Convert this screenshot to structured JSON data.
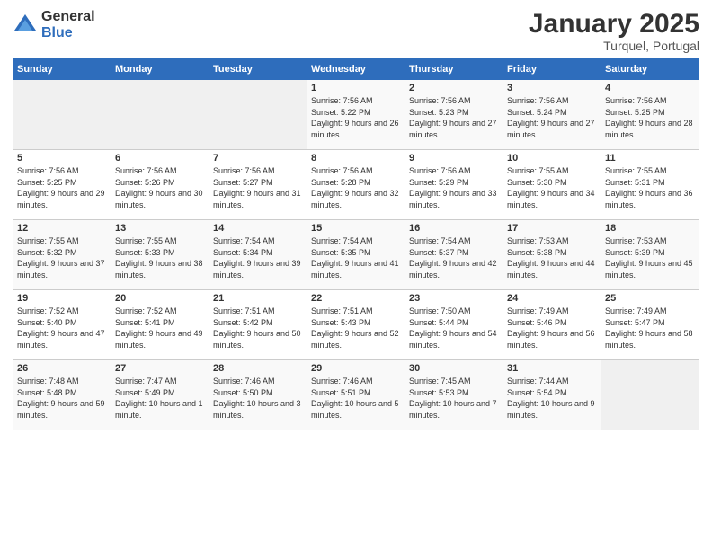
{
  "logo": {
    "text_general": "General",
    "text_blue": "Blue"
  },
  "header": {
    "title": "January 2025",
    "subtitle": "Turquel, Portugal"
  },
  "weekdays": [
    "Sunday",
    "Monday",
    "Tuesday",
    "Wednesday",
    "Thursday",
    "Friday",
    "Saturday"
  ],
  "weeks": [
    [
      {
        "day": "",
        "info": ""
      },
      {
        "day": "",
        "info": ""
      },
      {
        "day": "",
        "info": ""
      },
      {
        "day": "1",
        "info": "Sunrise: 7:56 AM\nSunset: 5:22 PM\nDaylight: 9 hours and 26 minutes."
      },
      {
        "day": "2",
        "info": "Sunrise: 7:56 AM\nSunset: 5:23 PM\nDaylight: 9 hours and 27 minutes."
      },
      {
        "day": "3",
        "info": "Sunrise: 7:56 AM\nSunset: 5:24 PM\nDaylight: 9 hours and 27 minutes."
      },
      {
        "day": "4",
        "info": "Sunrise: 7:56 AM\nSunset: 5:25 PM\nDaylight: 9 hours and 28 minutes."
      }
    ],
    [
      {
        "day": "5",
        "info": "Sunrise: 7:56 AM\nSunset: 5:25 PM\nDaylight: 9 hours and 29 minutes."
      },
      {
        "day": "6",
        "info": "Sunrise: 7:56 AM\nSunset: 5:26 PM\nDaylight: 9 hours and 30 minutes."
      },
      {
        "day": "7",
        "info": "Sunrise: 7:56 AM\nSunset: 5:27 PM\nDaylight: 9 hours and 31 minutes."
      },
      {
        "day": "8",
        "info": "Sunrise: 7:56 AM\nSunset: 5:28 PM\nDaylight: 9 hours and 32 minutes."
      },
      {
        "day": "9",
        "info": "Sunrise: 7:56 AM\nSunset: 5:29 PM\nDaylight: 9 hours and 33 minutes."
      },
      {
        "day": "10",
        "info": "Sunrise: 7:55 AM\nSunset: 5:30 PM\nDaylight: 9 hours and 34 minutes."
      },
      {
        "day": "11",
        "info": "Sunrise: 7:55 AM\nSunset: 5:31 PM\nDaylight: 9 hours and 36 minutes."
      }
    ],
    [
      {
        "day": "12",
        "info": "Sunrise: 7:55 AM\nSunset: 5:32 PM\nDaylight: 9 hours and 37 minutes."
      },
      {
        "day": "13",
        "info": "Sunrise: 7:55 AM\nSunset: 5:33 PM\nDaylight: 9 hours and 38 minutes."
      },
      {
        "day": "14",
        "info": "Sunrise: 7:54 AM\nSunset: 5:34 PM\nDaylight: 9 hours and 39 minutes."
      },
      {
        "day": "15",
        "info": "Sunrise: 7:54 AM\nSunset: 5:35 PM\nDaylight: 9 hours and 41 minutes."
      },
      {
        "day": "16",
        "info": "Sunrise: 7:54 AM\nSunset: 5:37 PM\nDaylight: 9 hours and 42 minutes."
      },
      {
        "day": "17",
        "info": "Sunrise: 7:53 AM\nSunset: 5:38 PM\nDaylight: 9 hours and 44 minutes."
      },
      {
        "day": "18",
        "info": "Sunrise: 7:53 AM\nSunset: 5:39 PM\nDaylight: 9 hours and 45 minutes."
      }
    ],
    [
      {
        "day": "19",
        "info": "Sunrise: 7:52 AM\nSunset: 5:40 PM\nDaylight: 9 hours and 47 minutes."
      },
      {
        "day": "20",
        "info": "Sunrise: 7:52 AM\nSunset: 5:41 PM\nDaylight: 9 hours and 49 minutes."
      },
      {
        "day": "21",
        "info": "Sunrise: 7:51 AM\nSunset: 5:42 PM\nDaylight: 9 hours and 50 minutes."
      },
      {
        "day": "22",
        "info": "Sunrise: 7:51 AM\nSunset: 5:43 PM\nDaylight: 9 hours and 52 minutes."
      },
      {
        "day": "23",
        "info": "Sunrise: 7:50 AM\nSunset: 5:44 PM\nDaylight: 9 hours and 54 minutes."
      },
      {
        "day": "24",
        "info": "Sunrise: 7:49 AM\nSunset: 5:46 PM\nDaylight: 9 hours and 56 minutes."
      },
      {
        "day": "25",
        "info": "Sunrise: 7:49 AM\nSunset: 5:47 PM\nDaylight: 9 hours and 58 minutes."
      }
    ],
    [
      {
        "day": "26",
        "info": "Sunrise: 7:48 AM\nSunset: 5:48 PM\nDaylight: 9 hours and 59 minutes."
      },
      {
        "day": "27",
        "info": "Sunrise: 7:47 AM\nSunset: 5:49 PM\nDaylight: 10 hours and 1 minute."
      },
      {
        "day": "28",
        "info": "Sunrise: 7:46 AM\nSunset: 5:50 PM\nDaylight: 10 hours and 3 minutes."
      },
      {
        "day": "29",
        "info": "Sunrise: 7:46 AM\nSunset: 5:51 PM\nDaylight: 10 hours and 5 minutes."
      },
      {
        "day": "30",
        "info": "Sunrise: 7:45 AM\nSunset: 5:53 PM\nDaylight: 10 hours and 7 minutes."
      },
      {
        "day": "31",
        "info": "Sunrise: 7:44 AM\nSunset: 5:54 PM\nDaylight: 10 hours and 9 minutes."
      },
      {
        "day": "",
        "info": ""
      }
    ]
  ]
}
